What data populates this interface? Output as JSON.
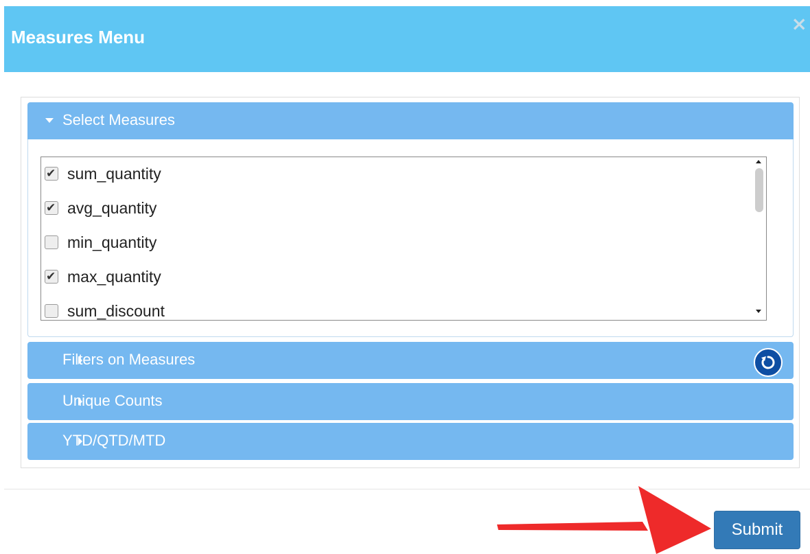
{
  "modal": {
    "title": "Measures Menu",
    "close_symbol": "×"
  },
  "accordion": {
    "select_measures": "Select Measures",
    "filters_on_measures": "Filters on Measures",
    "unique_counts": "Unique Counts",
    "ytd_qtd_mtd": "YTD/QTD/MTD"
  },
  "measures": [
    {
      "label": "sum_quantity",
      "checked": true
    },
    {
      "label": "avg_quantity",
      "checked": true
    },
    {
      "label": "min_quantity",
      "checked": false
    },
    {
      "label": "max_quantity",
      "checked": true
    },
    {
      "label": "sum_discount",
      "checked": false
    }
  ],
  "icons": {
    "close": "close-icon",
    "expanded": "caret-down-icon",
    "collapsed": "caret-right-icon",
    "reset": "refresh-icon",
    "pointer": "red-arrow-annotation"
  },
  "footer": {
    "submit_label": "Submit"
  },
  "colors": {
    "header": "#5fc6f3",
    "accordion": "#75b8f0",
    "submit": "#337ab7",
    "reset": "#0e4ea3",
    "annotation_arrow": "#ee2a2a"
  }
}
